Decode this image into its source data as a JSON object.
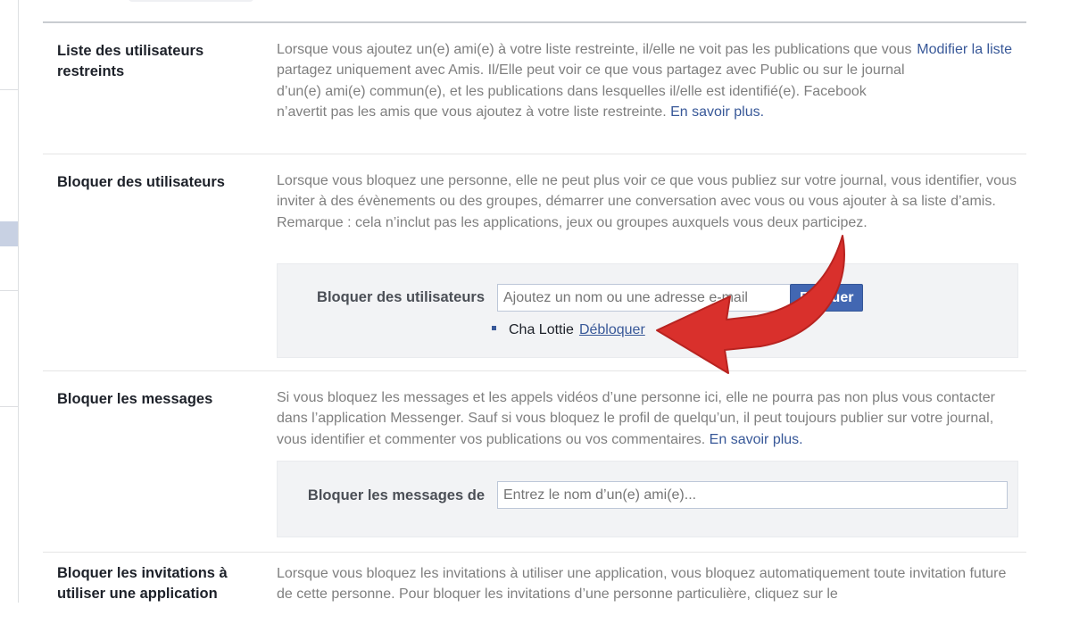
{
  "restricted": {
    "title": "Liste des utilisateurs restreints",
    "description": "Lorsque vous ajoutez un(e) ami(e) à votre liste restreinte, il/elle ne voit pas les publications que vous partagez uniquement avec Amis. Il/Elle peut voir ce que vous partagez avec Public ou sur le journal d’un(e) ami(e) commun(e), et les publications dans lesquelles il/elle est identifié(e). Facebook n’avertit pas les amis que vous ajoutez à votre liste restreinte.",
    "learn_more": "En savoir plus.",
    "edit_list": "Modifier la liste"
  },
  "block_users": {
    "title": "Bloquer des utilisateurs",
    "description": "Lorsque vous bloquez une personne, elle ne peut plus voir ce que vous publiez sur votre journal, vous identifier, vous inviter à des évènements ou des groupes, démarrer une conversation avec vous ou vous ajouter à sa liste d’amis. Remarque : cela n’inclut pas les applications, jeux ou groupes auxquels vous deux participez.",
    "field_label": "Bloquer des utilisateurs",
    "input_placeholder": "Ajoutez un nom ou une adresse e-mail",
    "button_label": "Bloquer",
    "blocked_list": [
      {
        "name": "Cha Lottie",
        "action": "Débloquer"
      }
    ]
  },
  "block_messages": {
    "title": "Bloquer les messages",
    "description": "Si vous bloquez les messages et les appels vidéos d’une personne ici, elle ne pourra pas non plus vous contacter dans l’application Messenger. Sauf si vous bloquez le profil de quelqu’un, il peut toujours publier sur votre journal, vous identifier et commenter vos publications ou vos commentaires.",
    "learn_more": "En savoir plus.",
    "field_label": "Bloquer les messages de",
    "input_placeholder": "Entrez le nom d’un(e) ami(e)..."
  },
  "block_app_invites": {
    "title": "Bloquer les invitations à utiliser une application",
    "description": "Lorsque vous bloquez les invitations à utiliser une application, vous bloquez automatiquement toute invitation future de cette personne. Pour bloquer les invitations d’une personne particulière, cliquez sur le"
  },
  "colors": {
    "link": "#385898",
    "button": "#4267b2",
    "arrow": "#d9302c"
  },
  "icons": {
    "arrow": "curved-arrow-icon",
    "bullet": "bullet-icon"
  }
}
